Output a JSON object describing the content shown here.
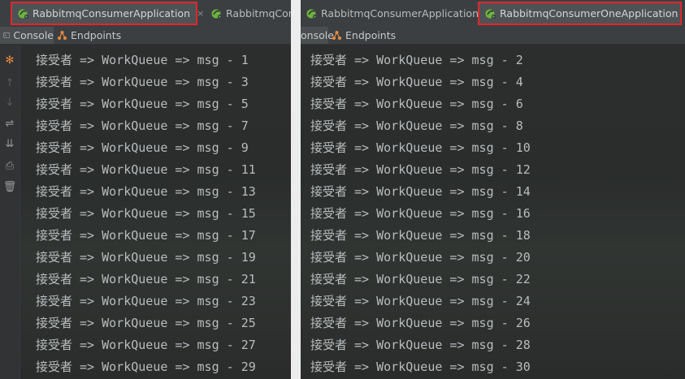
{
  "left_panel": {
    "tabs": [
      {
        "label": "RabbitmqConsumerApplication",
        "active": true,
        "highlighted": true,
        "close": "×"
      },
      {
        "label": "RabbitmqConsumerApplication",
        "active": false,
        "highlighted": false,
        "close": ""
      }
    ],
    "tool_tabs": [
      {
        "label": "Console",
        "active": true,
        "icon": "console-icon"
      },
      {
        "label": "Endpoints",
        "active": false,
        "icon": "endpoints-icon"
      }
    ],
    "gutter_icons": [
      "rerun-icon",
      "up-arrow-icon",
      "down-arrow-icon",
      "soft-wrap-icon",
      "scroll-to-end-icon",
      "print-icon",
      "trash-icon"
    ],
    "console_lines": [
      "接受者 => WorkQueue => msg - 1",
      "接受者 => WorkQueue => msg - 3",
      "接受者 => WorkQueue => msg - 5",
      "接受者 => WorkQueue => msg - 7",
      "接受者 => WorkQueue => msg - 9",
      "接受者 => WorkQueue => msg - 11",
      "接受者 => WorkQueue => msg - 13",
      "接受者 => WorkQueue => msg - 15",
      "接受者 => WorkQueue => msg - 17",
      "接受者 => WorkQueue => msg - 19",
      "接受者 => WorkQueue => msg - 21",
      "接受者 => WorkQueue => msg - 23",
      "接受者 => WorkQueue => msg - 25",
      "接受者 => WorkQueue => msg - 27",
      "接受者 => WorkQueue => msg - 29"
    ]
  },
  "right_panel": {
    "tabs": [
      {
        "label": "RabbitmqConsumerApplication",
        "active": false,
        "highlighted": false,
        "close": "×"
      },
      {
        "label": "RabbitmqConsumerOneApplication",
        "active": true,
        "highlighted": true,
        "close": "×"
      }
    ],
    "tool_tabs": [
      {
        "label": "onsole",
        "active": true,
        "icon": ""
      },
      {
        "label": "Endpoints",
        "active": false,
        "icon": "endpoints-icon"
      }
    ],
    "console_lines": [
      "接受者 => WorkQueue => msg - 2",
      "接受者 => WorkQueue => msg - 4",
      "接受者 => WorkQueue => msg - 6",
      "接受者 => WorkQueue => msg - 8",
      "接受者 => WorkQueue => msg - 10",
      "接受者 => WorkQueue => msg - 12",
      "接受者 => WorkQueue => msg - 14",
      "接受者 => WorkQueue => msg - 16",
      "接受者 => WorkQueue => msg - 18",
      "接受者 => WorkQueue => msg - 20",
      "接受者 => WorkQueue => msg - 22",
      "接受者 => WorkQueue => msg - 24",
      "接受者 => WorkQueue => msg - 26",
      "接受者 => WorkQueue => msg - 28",
      "接受者 => WorkQueue => msg - 30"
    ]
  },
  "colors": {
    "highlight_box": "#e0282a",
    "console_text": "#b9bcbe",
    "background": "#2b2b2b"
  }
}
